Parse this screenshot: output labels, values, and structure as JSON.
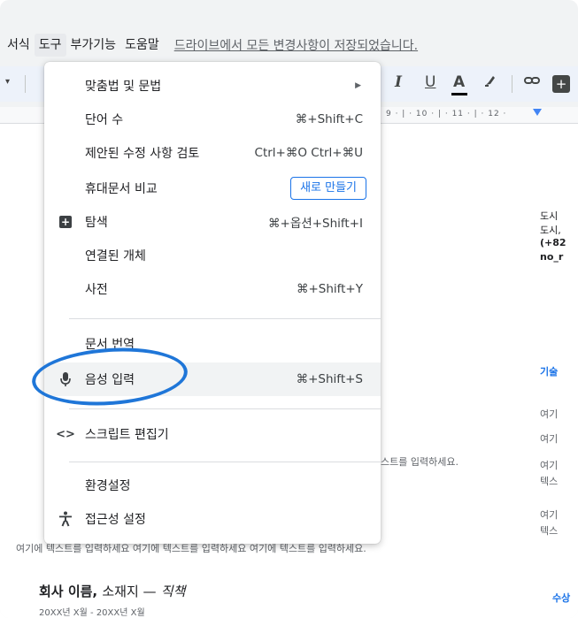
{
  "menubar": {
    "items": [
      {
        "label": "서식"
      },
      {
        "label": "도구"
      },
      {
        "label": "부가기능"
      },
      {
        "label": "도움말"
      }
    ],
    "save_status": "드라이브에서 모든 변경사항이 저장되었습니다."
  },
  "toolbar": {
    "italic": "I",
    "underline": "U",
    "text_color": "A",
    "highlight_icon": "highlighter-icon",
    "link_icon": "link-icon",
    "comment_icon": "add-comment-icon"
  },
  "ruler": {
    "ticks": "9 · | · 10 · | · 11 · | · 12 ·"
  },
  "tools_menu": {
    "items": [
      {
        "label": "맞춤법 및 문법",
        "shortcut": "",
        "submenu": true
      },
      {
        "label": "단어 수",
        "shortcut": "⌘+Shift+C"
      },
      {
        "label": "제안된 수정 사항 검토",
        "shortcut": "Ctrl+⌘O Ctrl+⌘U"
      },
      {
        "label": "휴대문서 비교",
        "button": "새로 만들기"
      },
      {
        "label": "탐색",
        "shortcut": "⌘+옵션+Shift+I",
        "icon": "explore-icon"
      },
      {
        "label": "연결된 개체",
        "shortcut": ""
      },
      {
        "label": "사전",
        "shortcut": "⌘+Shift+Y"
      },
      {
        "label": "문서 번역",
        "shortcut": ""
      },
      {
        "label": "음성 입력",
        "shortcut": "⌘+Shift+S",
        "icon": "microphone-icon"
      },
      {
        "label": "스크립트 편집기",
        "shortcut": "",
        "icon": "code-icon"
      },
      {
        "label": "환경설정",
        "shortcut": ""
      },
      {
        "label": "접근성 설정",
        "shortcut": "",
        "icon": "accessibility-icon"
      }
    ]
  },
  "document": {
    "right_col": [
      "도시",
      "도시,",
      "(+82",
      "no_r"
    ],
    "skills_heading": "기술",
    "right_lines": [
      "여기",
      "여기",
      "여기",
      "텍스",
      "여기",
      "텍스"
    ],
    "awards_heading": "수상",
    "body_line_1": "스트를 입력하세요.",
    "body_line_2": "여기에 텍스트를 입력하세요 여기에 텍스트를 입력하세요 여기에 텍스트를 입력하세요.",
    "company_name": "회사 이름,",
    "company_loc": "소재지 —",
    "company_title": "직책",
    "date_range": "20XX년 X월 - 20XX년 X월"
  },
  "colors": {
    "accent": "#1a73e8",
    "annotation": "#1f76d8"
  }
}
